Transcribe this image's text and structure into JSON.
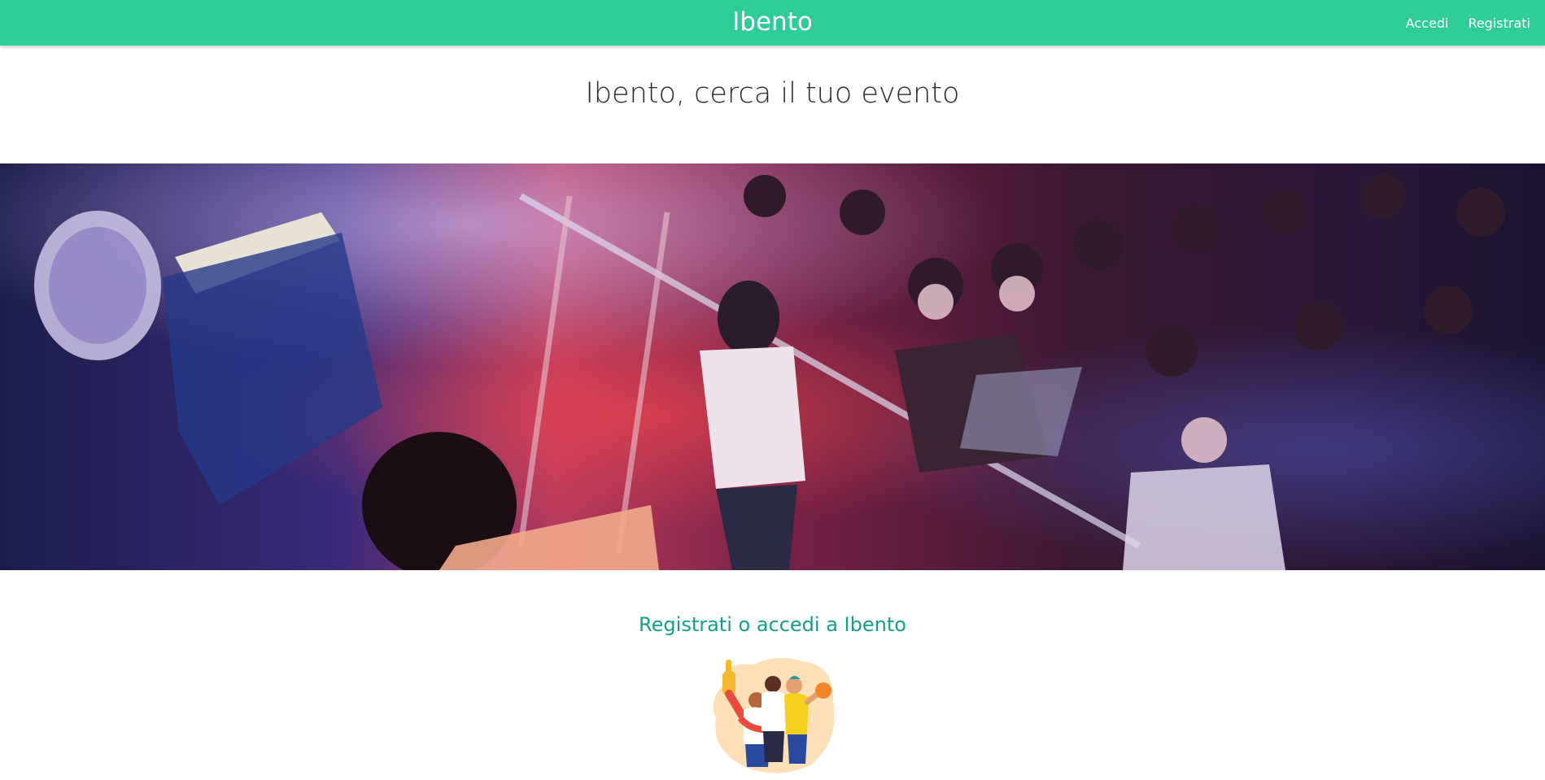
{
  "navbar": {
    "brand": "Ibento",
    "links": [
      {
        "label": "Accedi"
      },
      {
        "label": "Registrati"
      }
    ],
    "background_color": "#2ecc97"
  },
  "main": {
    "title": "Ibento, cerca il tuo evento",
    "hero_image": "concert-crowd-photo",
    "auth_heading": "Registrati o accedi a Ibento",
    "auth_heading_color": "#13a08a",
    "illustration": "cheering-fans-illustration"
  }
}
